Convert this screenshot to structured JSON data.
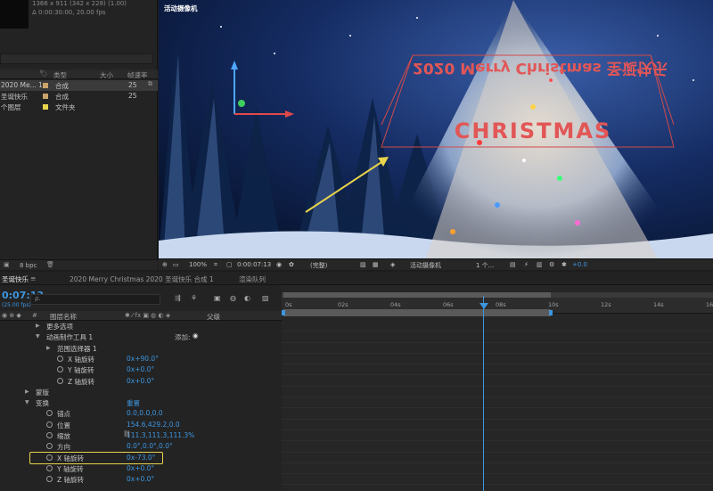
{
  "project": {
    "info_line1": "1366 x 911 (342 x 228) (1.00)",
    "info_line2": "Δ 0:00:30:00, 20.00 fps",
    "columns": {
      "type": "类型",
      "size": "大小",
      "fps": "帧速率"
    },
    "items": [
      {
        "name": "2020 Me... 1",
        "type": "合成",
        "fps": "25",
        "color": "#c9a46a",
        "selected": true
      },
      {
        "name": "圣诞快乐",
        "type": "合成",
        "fps": "25",
        "color": "#c9a46a",
        "selected": false
      },
      {
        "name": "个图层",
        "type": "文件夹",
        "fps": "",
        "color": "#e8d44c",
        "selected": false
      }
    ],
    "bpc": "8 bpc"
  },
  "viewer": {
    "camera_label": "活动摄像机",
    "banner_top": "2020 Merry Christmas 圣诞快乐",
    "banner_bottom": "CHRISTMAS",
    "footer": {
      "zoom": "100%",
      "timecode": "0:00:07:13",
      "resolution": "(完整)",
      "camera": "活动摄像机",
      "views": "1 个...",
      "exposure": "+0.0"
    }
  },
  "timeline": {
    "tab_comp": "圣诞快乐",
    "tab_sep": "≡",
    "tab_other": "2020 Merry Christmas 2020 圣诞快乐 合成 1",
    "tab_render": "渲染队列",
    "current_time": "0:07:13",
    "fps_sub": "(25.00 fps)",
    "search_placeholder": "ρ.",
    "col_layer_name": "图层名称",
    "col_parent": "父级",
    "ruler_labels": [
      "0s",
      "02s",
      "04s",
      "06s",
      "08s",
      "10s",
      "12s",
      "14s",
      "16s"
    ],
    "add_label": "添加:",
    "rows": [
      {
        "indent": 52,
        "name": "更多选项",
        "value": "",
        "stopwatch": false,
        "tri": "▶"
      },
      {
        "indent": 52,
        "name": "动画制作工具 1",
        "value": "",
        "stopwatch": false,
        "tri": "▼",
        "add": true
      },
      {
        "indent": 64,
        "name": "范围选择器 1",
        "value": "",
        "stopwatch": false,
        "tri": "▶"
      },
      {
        "indent": 76,
        "name": "X 轴旋转",
        "value": "0x+90.0°",
        "stopwatch": true,
        "tri": ""
      },
      {
        "indent": 76,
        "name": "Y 轴旋转",
        "value": "0x+0.0°",
        "stopwatch": true,
        "tri": ""
      },
      {
        "indent": 76,
        "name": "Z 轴旋转",
        "value": "0x+0.0°",
        "stopwatch": true,
        "tri": ""
      },
      {
        "indent": 40,
        "name": "蒙版",
        "value": "",
        "stopwatch": false,
        "tri": "▶"
      },
      {
        "indent": 40,
        "name": "变换",
        "value": "重置",
        "stopwatch": false,
        "tri": "▼"
      },
      {
        "indent": 64,
        "name": "锚点",
        "value": "0.0,0.0,0.0",
        "stopwatch": true,
        "tri": ""
      },
      {
        "indent": 64,
        "name": "位置",
        "value": "154.6,429.2,0.0",
        "stopwatch": true,
        "tri": ""
      },
      {
        "indent": 64,
        "name": "缩放",
        "value": "111.3,111.3,111.3%",
        "stopwatch": true,
        "tri": ""
      },
      {
        "indent": 64,
        "name": "方向",
        "value": "0.0°,0.0°,0.0°",
        "stopwatch": true,
        "tri": ""
      },
      {
        "indent": 64,
        "name": "X 轴旋转",
        "value": "0x-73.0°",
        "stopwatch": true,
        "tri": "",
        "highlight": true
      },
      {
        "indent": 64,
        "name": "Y 轴旋转",
        "value": "0x+0.0°",
        "stopwatch": true,
        "tri": ""
      },
      {
        "indent": 64,
        "name": "Z 轴旋转",
        "value": "0x+0.0°",
        "stopwatch": true,
        "tri": ""
      }
    ]
  }
}
